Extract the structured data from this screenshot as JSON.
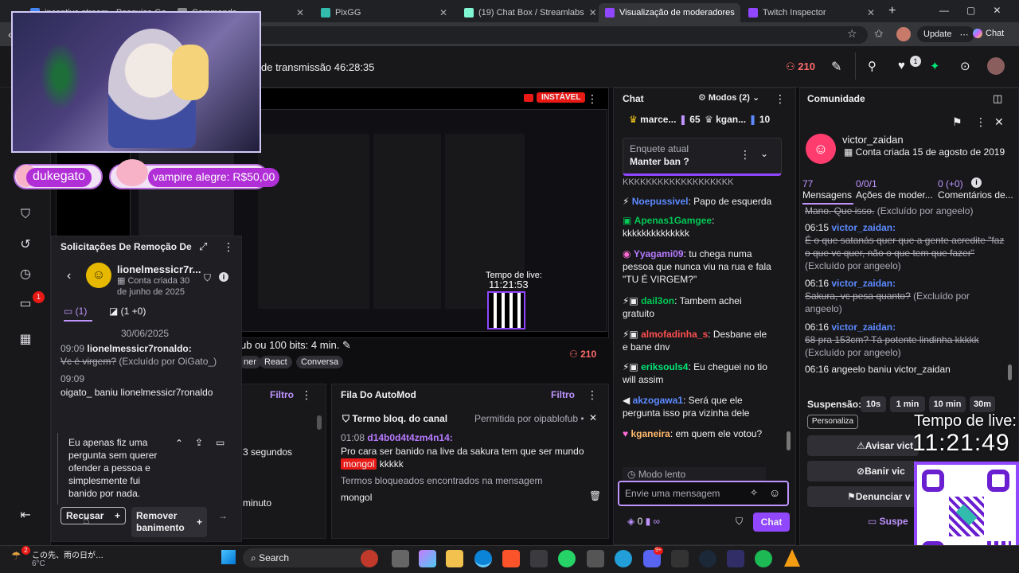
{
  "browser": {
    "tabs": [
      {
        "label": "incentive stream - Pesquisa Go",
        "color": "#4285f4"
      },
      {
        "label": "Commands",
        "color": "#888888"
      },
      {
        "label": "PixGG",
        "color": "#32bcad"
      },
      {
        "label": "(19) Chat Box / Streamlabs",
        "color": "#80f5d2"
      },
      {
        "label": "Visualização de moderadores",
        "color": "#9146ff"
      },
      {
        "label": "Twitch Inspector",
        "color": "#9146ff"
      }
    ],
    "update_label": "Update",
    "chat_label": "Chat"
  },
  "topbar": {
    "title": "de transmissão 46:28:35",
    "viewers": "210"
  },
  "overlay": {
    "user1": "dukegato",
    "alert": "vampire alegre: R$50,00",
    "live_time_label": "Tempo de live:",
    "live_time": "11:21:49",
    "small_live_label": "Tempo de live:",
    "small_live_time": "11:21:53"
  },
  "stream": {
    "status": "INSTÁVEL",
    "title_tail": "ub ou 100 bits: 4 min.",
    "viewers": "210",
    "tags": [
      "ner",
      "React",
      "Conversa"
    ]
  },
  "unban": {
    "title": "Solicitações De Remoção De B",
    "username": "lionelmessicr7r...",
    "account_created": "Conta criada 30 de junho de 2025",
    "tab1": "(1)",
    "tab2": "(1 +0)",
    "date": "30/06/2025",
    "msg1_time": "09:09",
    "msg1_user": "lionelmessicr7ronaldo:",
    "msg1_text": "Vc é virgem?",
    "msg1_note": "(Excluído por OiGato_)",
    "msg2_time": "09:09",
    "msg2_text": "oigato_ baniu lionelmessicr7ronaldo",
    "request_text": "Eu apenas fiz uma pergunta sem querer ofender a pessoa e simplesmente fui banido por nada.",
    "reject_label": "Recusar",
    "remove_label": "Remover banimento"
  },
  "middle": {
    "filter_label": "Filtro",
    "partial1": "3 segundos",
    "partial2": "minuto"
  },
  "automod": {
    "title": "Fila Do AutoMod",
    "filter_label": "Filtro",
    "term_label": "Termo bloq. do canal",
    "allowed": "Permitida por oipablofub •",
    "time": "01:08",
    "user": "d14b0d4t4zm4n14:",
    "message_pre": "Pro cara ser banido na live da sakura tem que ser mundo",
    "term": "mongol",
    "message_post": "kkkkk",
    "blocked_label": "Termos bloqueados encontrados na mensagem",
    "blocked_term": "mongol"
  },
  "chat": {
    "title": "Chat",
    "modes": "Modos (2)",
    "top_users": [
      {
        "name": "marce...",
        "count": "65"
      },
      {
        "name": "kgan...",
        "count": "10"
      }
    ],
    "poll_label": "Enquete atual",
    "poll_question": "Manter ban ?",
    "partial": "KKKKKKKKKKKKKKKKKKK",
    "messages": [
      {
        "user": "Noepussivel",
        "color": "#5c8aff",
        "text": "Papo de esquerda"
      },
      {
        "user": "Apenas1Gamgee",
        "color": "#00c853",
        "text": "kkkkkkkkkkkkkk"
      },
      {
        "user": "Yyagami09",
        "color": "#b77aff",
        "text": "tu chega numa pessoa que nunca viu na rua e fala \"TU É VIRGEM?\""
      },
      {
        "user": "dail3on",
        "color": "#00c853",
        "text": "Tambem achei gratuito"
      },
      {
        "user": "almofadinha_s",
        "color": "#ff4f4f",
        "text": "Desbane ele e bane dnv"
      },
      {
        "user": "eriksouls4",
        "color": "#00e676",
        "text": "Eu cheguei no tio will assim"
      },
      {
        "user": "akzogawa1",
        "color": "#5c8aff",
        "text": "Será que ele pergunta isso pra vizinha dele"
      },
      {
        "user": "kganeira",
        "color": "#ffb86b",
        "text": "em quem ele votou?"
      }
    ],
    "slow_mode": "Modo lento",
    "input_placeholder": "Envie uma mensagem",
    "points": "0",
    "send_label": "Chat"
  },
  "community": {
    "title": "Comunidade",
    "username": "victor_zaidan",
    "created": "Conta criada 15 de agosto de 2019",
    "stats": [
      {
        "value": "77",
        "label": "Mensagens"
      },
      {
        "value": "0/0/1",
        "label": "Ações de moder..."
      },
      {
        "value": "0 (+0)",
        "label": "Comentários de..."
      }
    ],
    "messages": [
      {
        "time": "",
        "user": "",
        "text": "Mano. Que isso.",
        "note": "(Excluído por angeelo)"
      },
      {
        "time": "06:15",
        "user": "victor_zaidan:",
        "text": "É o que satanás quer que a gente acredite \"faz o que vc quer, não o que tem que fazer\"",
        "note": "(Excluído por angeelo)"
      },
      {
        "time": "06:16",
        "user": "victor_zaidan:",
        "text": "Sakura, vc pesa quanto?",
        "note": "(Excluído por angeelo)"
      },
      {
        "time": "06:16",
        "user": "victor_zaidan:",
        "text": "68 pra 153cm? Tá potente lindinha kkkkk",
        "note": "(Excluído por angeelo)"
      },
      {
        "time": "06:16",
        "user": "",
        "text": "angeelo baniu victor_zaidan",
        "note": ""
      }
    ],
    "suspension_label": "Suspensão:",
    "durations": [
      "10s",
      "1 min",
      "10 min",
      "30m"
    ],
    "personalize": "Personaliza",
    "warn_label": "Avisar vict",
    "ban_label": "Banir vic",
    "report_label": "Denunciar v",
    "suspicious_label": "Suspe"
  },
  "taskbar": {
    "weather_text": "この先、雨の日が…",
    "temperature": "6°C",
    "search_label": "Search",
    "accent": "#9146ff"
  }
}
